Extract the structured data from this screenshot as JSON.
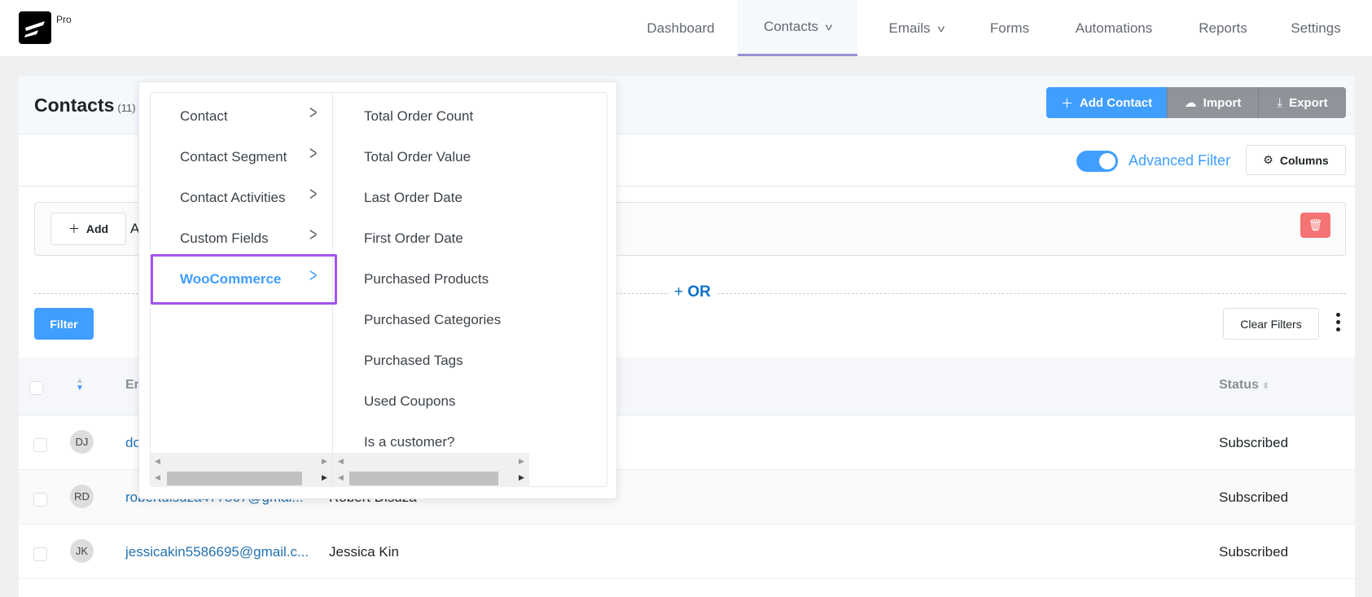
{
  "header": {
    "logo_badge": "Pro",
    "nav": [
      {
        "label": "Dashboard"
      },
      {
        "label": "Contacts",
        "has_dropdown": true,
        "active": true
      },
      {
        "label": "Emails",
        "has_dropdown": true
      },
      {
        "label": "Forms"
      },
      {
        "label": "Automations"
      },
      {
        "label": "Reports"
      },
      {
        "label": "Settings"
      }
    ]
  },
  "page": {
    "title": "Contacts",
    "count": "(11)"
  },
  "toolbar": {
    "add_contact": "Add Contact",
    "import": "Import",
    "export": "Export"
  },
  "filterbar": {
    "advanced_filter_label": "Advanced Filter",
    "advanced_filter_on": true,
    "columns": "Columns",
    "add": "Add",
    "add_trailing": "A",
    "or": "OR",
    "filter": "Filter",
    "clear_filters": "Clear Filters"
  },
  "table": {
    "headers": {
      "email": "Er",
      "status": "Status"
    },
    "rows": [
      {
        "initials": "DJ",
        "email": "do",
        "name": "",
        "status": "Subscribed"
      },
      {
        "initials": "RD",
        "email": "robertdisuza477867@gmai...",
        "name": "Robert Disuza",
        "status": "Subscribed"
      },
      {
        "initials": "JK",
        "email": "jessicakin5586695@gmail.c...",
        "name": "Jessica Kin",
        "status": "Subscribed"
      }
    ]
  },
  "dropdown": {
    "categories": [
      "Contact",
      "Contact Segment",
      "Contact Activities",
      "Custom Fields",
      "WooCommerce"
    ],
    "selected_category": "WooCommerce",
    "options": [
      "Total Order Count",
      "Total Order Value",
      "Last Order Date",
      "First Order Date",
      "Purchased Products",
      "Purchased Categories",
      "Purchased Tags",
      "Used Coupons",
      "Is a customer?"
    ]
  },
  "colors": {
    "primary": "#409eff",
    "highlight": "#a155f0",
    "danger": "#f47373",
    "nav_active": "#9a8fd6"
  }
}
